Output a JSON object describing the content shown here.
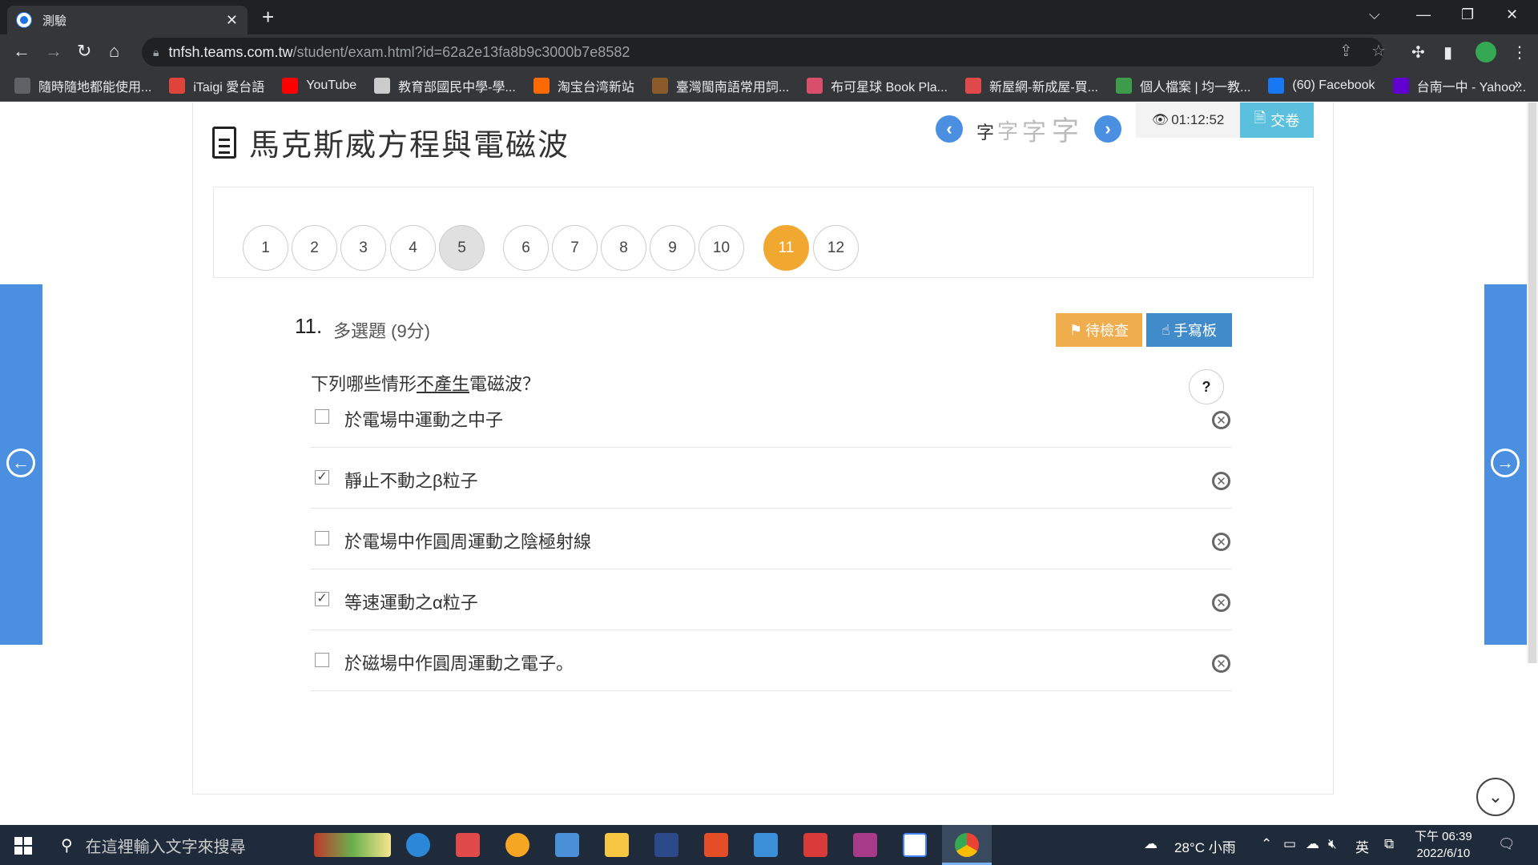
{
  "browser": {
    "tab_title": "測驗",
    "url_host": "tnfsh.teams.com.tw",
    "url_path": "/student/exam.html?id=62a2e13fa8b9c3000b7e8582"
  },
  "bookmarks": [
    {
      "label": "隨時隨地都能使用...",
      "color": "#5f6368"
    },
    {
      "label": "iTaigi 愛台語",
      "color": "#e0433a"
    },
    {
      "label": "YouTube",
      "color": "#ff0000"
    },
    {
      "label": "教育部國民中學-學...",
      "color": "#cccccc"
    },
    {
      "label": "淘宝台湾新站",
      "color": "#ff6a00"
    },
    {
      "label": "臺灣閩南語常用詞...",
      "color": "#8b5a2b"
    },
    {
      "label": "布可星球 Book Pla...",
      "color": "#d94f6b"
    },
    {
      "label": "新屋網-新成屋-買...",
      "color": "#e04a4a"
    },
    {
      "label": "個人檔案 | 均一教...",
      "color": "#3d9b4a"
    },
    {
      "label": "(60) Facebook",
      "color": "#1877f2"
    },
    {
      "label": "台南一中 - Yahoo...",
      "color": "#6001d2"
    }
  ],
  "exam": {
    "title": "馬克斯威方程與電磁波",
    "font_size_glyph": "字",
    "timer": "01:12:52",
    "submit_label": "交卷"
  },
  "question_nav": [
    "1",
    "2",
    "3",
    "4",
    "5",
    "6",
    "7",
    "8",
    "9",
    "10",
    "11",
    "12"
  ],
  "question": {
    "number": "11.",
    "type": "多選題 (9分)",
    "pending_label": "待檢查",
    "handwrite_label": "手寫板",
    "help_label": "?",
    "stem_before": "下列哪些情形",
    "stem_underline": "不產生",
    "stem_after": "電磁波？",
    "options": [
      {
        "text": "於電場中運動之中子",
        "checked": false
      },
      {
        "text": "靜止不動之β粒子",
        "checked": true
      },
      {
        "text": "於電場中作圓周運動之陰極射線",
        "checked": false
      },
      {
        "text": "等速運動之α粒子",
        "checked": true
      },
      {
        "text": "於磁場中作圓周運動之電子。",
        "checked": false
      }
    ]
  },
  "taskbar": {
    "search_placeholder": "在這裡輸入文字來搜尋",
    "weather": "28°C 小雨",
    "ime": "英",
    "time": "下午 06:39",
    "date": "2022/6/10"
  },
  "colors": {
    "accent_blue": "#4a8fe0",
    "current_question": "#f0a830",
    "submit": "#5bc0de",
    "pending": "#f0ad4e",
    "handwrite": "#428bca"
  }
}
